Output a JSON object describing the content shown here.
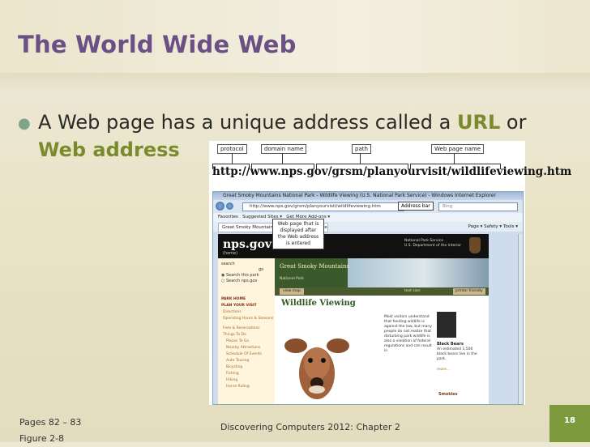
{
  "slide": {
    "title": "The World Wide Web",
    "bullet": {
      "pre": "A Web page has a unique address called a ",
      "term1": "URL",
      "mid": " or",
      "term2": "Web address"
    },
    "footer": {
      "pages": "Pages 82 – 83",
      "figure": "Figure 2-8",
      "center": "Discovering Computers 2012: Chapter 2",
      "page_number": "18"
    }
  },
  "figure": {
    "callouts": {
      "protocol": "protocol",
      "domain_name": "domain name",
      "path": "path",
      "web_page_name": "Web page name",
      "address_bar": "Address bar",
      "web_page_displayed": "Web page that is displayed after the Web address is entered"
    },
    "url": "http://www.nps.gov/grsm/planyourvisit/wildlifeviewing.htm",
    "browser": {
      "window_title": "Great Smoky Mountains National Park - Wildlife Viewing (U.S. National Park Service) - Windows Internet Explorer",
      "address_value": "http://www.nps.gov/grsm/planyourvisit/wildlifeviewing.htm",
      "search_placeholder": "Bing",
      "favorites": "Favorites",
      "suggested_sites": "Suggested Sites ▾",
      "get_more_addons": "Get More Add-ons ▾",
      "tab_label": "Great Smoky Mountains National Park - Wildlife ...",
      "commands": "Page ▾  Safety ▾  Tools ▾"
    },
    "webpage": {
      "logo": "nps.gov",
      "home": "(home)",
      "agency_line1": "National Park Service",
      "agency_line2": "U.S. Department of the Interior",
      "search_label": "search",
      "search_button": "go",
      "search_opt1": "Search this park",
      "search_opt2": "Search nps.gov",
      "park_home": "PARK HOME",
      "plan_visit": "PLAN YOUR VISIT",
      "side_links": [
        "Directions",
        "Operating Hours & Seasons",
        "Fees & Reservations",
        "Things To Do",
        "Places To Go",
        "Nearby Attractions",
        "Schedule Of Events",
        "Auto Touring",
        "Bicycling",
        "Fishing",
        "Hiking",
        "Horse Riding"
      ],
      "banner_title": "Great Smoky Mountains",
      "banner_sub": "National Park",
      "view_map": "view map",
      "text_size": "text size:",
      "printer_friendly": "printer friendly",
      "heading": "Wildlife Viewing",
      "body": "Most visitors understand that feeding wildlife is against the law, but many people do not realize that disturbing park wildlife is also a violation of federal regulations and can result in",
      "bear_title": "Black Bears",
      "bear_text": "An estimated 1,500 black bears live in the park.",
      "more": "more...",
      "smokies": "Smokies"
    }
  }
}
